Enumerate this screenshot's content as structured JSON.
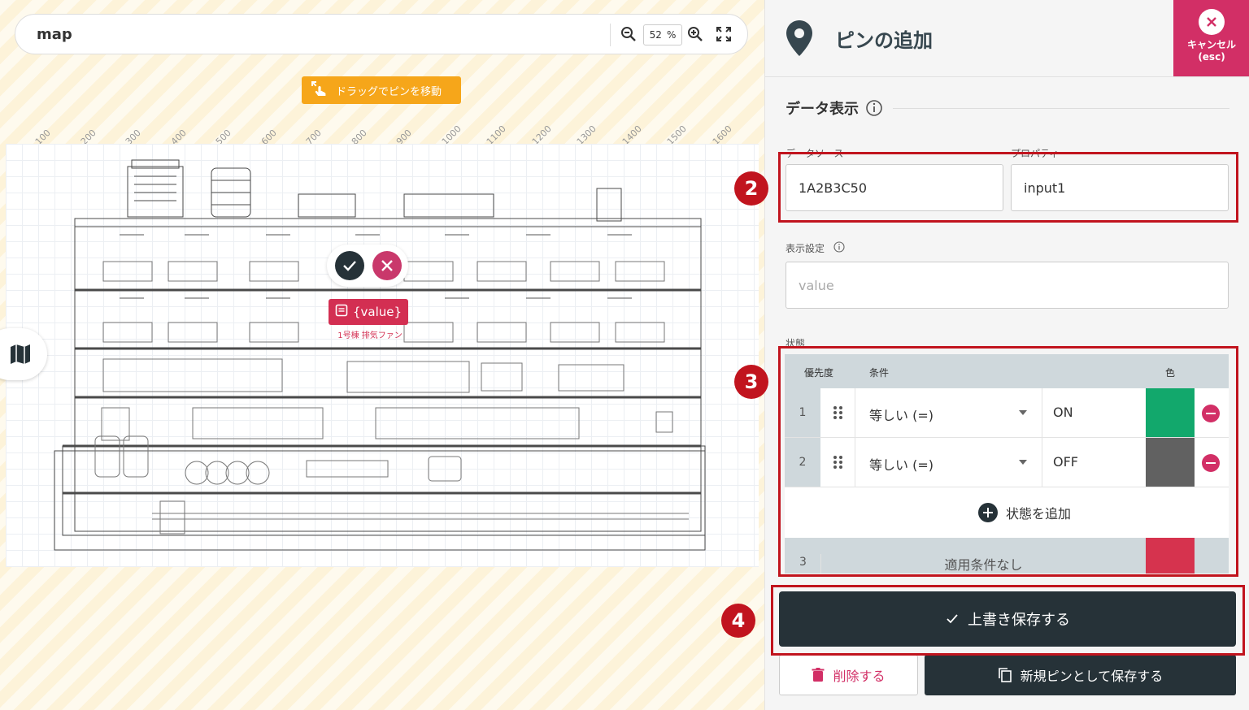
{
  "map": {
    "title": "map",
    "zoom_value": "52",
    "zoom_unit": "%",
    "drag_hint": "ドラッグでピンを移動",
    "ruler_ticks": [
      "100",
      "200",
      "300",
      "400",
      "500",
      "600",
      "700",
      "800",
      "900",
      "1000",
      "1100",
      "1200",
      "1300",
      "1400",
      "1500",
      "1600"
    ],
    "pin_label": "{value}",
    "pin_subtitle": "1号棟 排気ファン"
  },
  "panel": {
    "title": "ピンの追加",
    "cancel_label": "キャンセル",
    "cancel_hint": "(esc)",
    "section_title": "データ表示",
    "datasource_label": "データソース",
    "datasource_value": "1A2B3C50",
    "property_label": "プロパティ",
    "property_value": "input1",
    "display_label": "表示設定",
    "display_placeholder": "value",
    "state_label": "状態",
    "table_headers": {
      "priority": "優先度",
      "condition": "条件",
      "color": "色"
    },
    "rows": [
      {
        "priority": "1",
        "condition": "等しい (=)",
        "value": "ON",
        "color": "#12a86c"
      },
      {
        "priority": "2",
        "condition": "等しい (=)",
        "value": "OFF",
        "color": "#616161"
      }
    ],
    "add_state": "状態を追加",
    "default_row": {
      "priority": "3",
      "label": "適用条件なし",
      "color": "#d6334e"
    },
    "save_label": "上書き保存する",
    "delete_label": "削除する",
    "save_as_label": "新規ピンとして保存する"
  },
  "steps": {
    "s2": "2",
    "s3": "3",
    "s4": "4"
  },
  "colors": {
    "accent": "#d22f66",
    "dark": "#263238",
    "warning": "#f6a61a",
    "frame": "#c1141e"
  }
}
